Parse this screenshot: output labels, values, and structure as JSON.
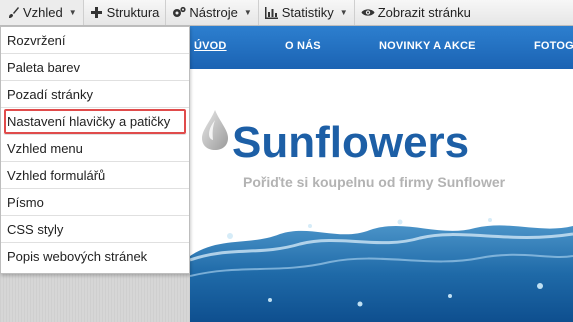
{
  "toolbar": {
    "items": [
      {
        "label": "Vzhled",
        "icon": "brush-icon"
      },
      {
        "label": "Struktura",
        "icon": "plus-icon"
      },
      {
        "label": "Nástroje",
        "icon": "gears-icon"
      },
      {
        "label": "Statistiky",
        "icon": "bar-chart-icon"
      },
      {
        "label": "Zobrazit stránku",
        "icon": "eye-icon"
      }
    ]
  },
  "menu": {
    "items": [
      {
        "label": "Rozvržení"
      },
      {
        "label": "Paleta barev"
      },
      {
        "label": "Pozadí stránky"
      },
      {
        "label": "Nastavení hlavičky a patičky"
      },
      {
        "label": "Vzhled menu"
      },
      {
        "label": "Vzhled formulářů"
      },
      {
        "label": "Písmo"
      },
      {
        "label": "CSS styly"
      },
      {
        "label": "Popis webových stránek"
      }
    ]
  },
  "site": {
    "nav": [
      "ÚVOD",
      "O NÁS",
      "NOVINKY A AKCE",
      "FOTOG"
    ],
    "brand": "Sunflowers",
    "tagline": "Pořiďte si koupelnu od firmy Sunflower"
  },
  "colors": {
    "nav": "#1b63b3",
    "brand": "#1d5fa6",
    "highlight": "#e04b4b"
  }
}
